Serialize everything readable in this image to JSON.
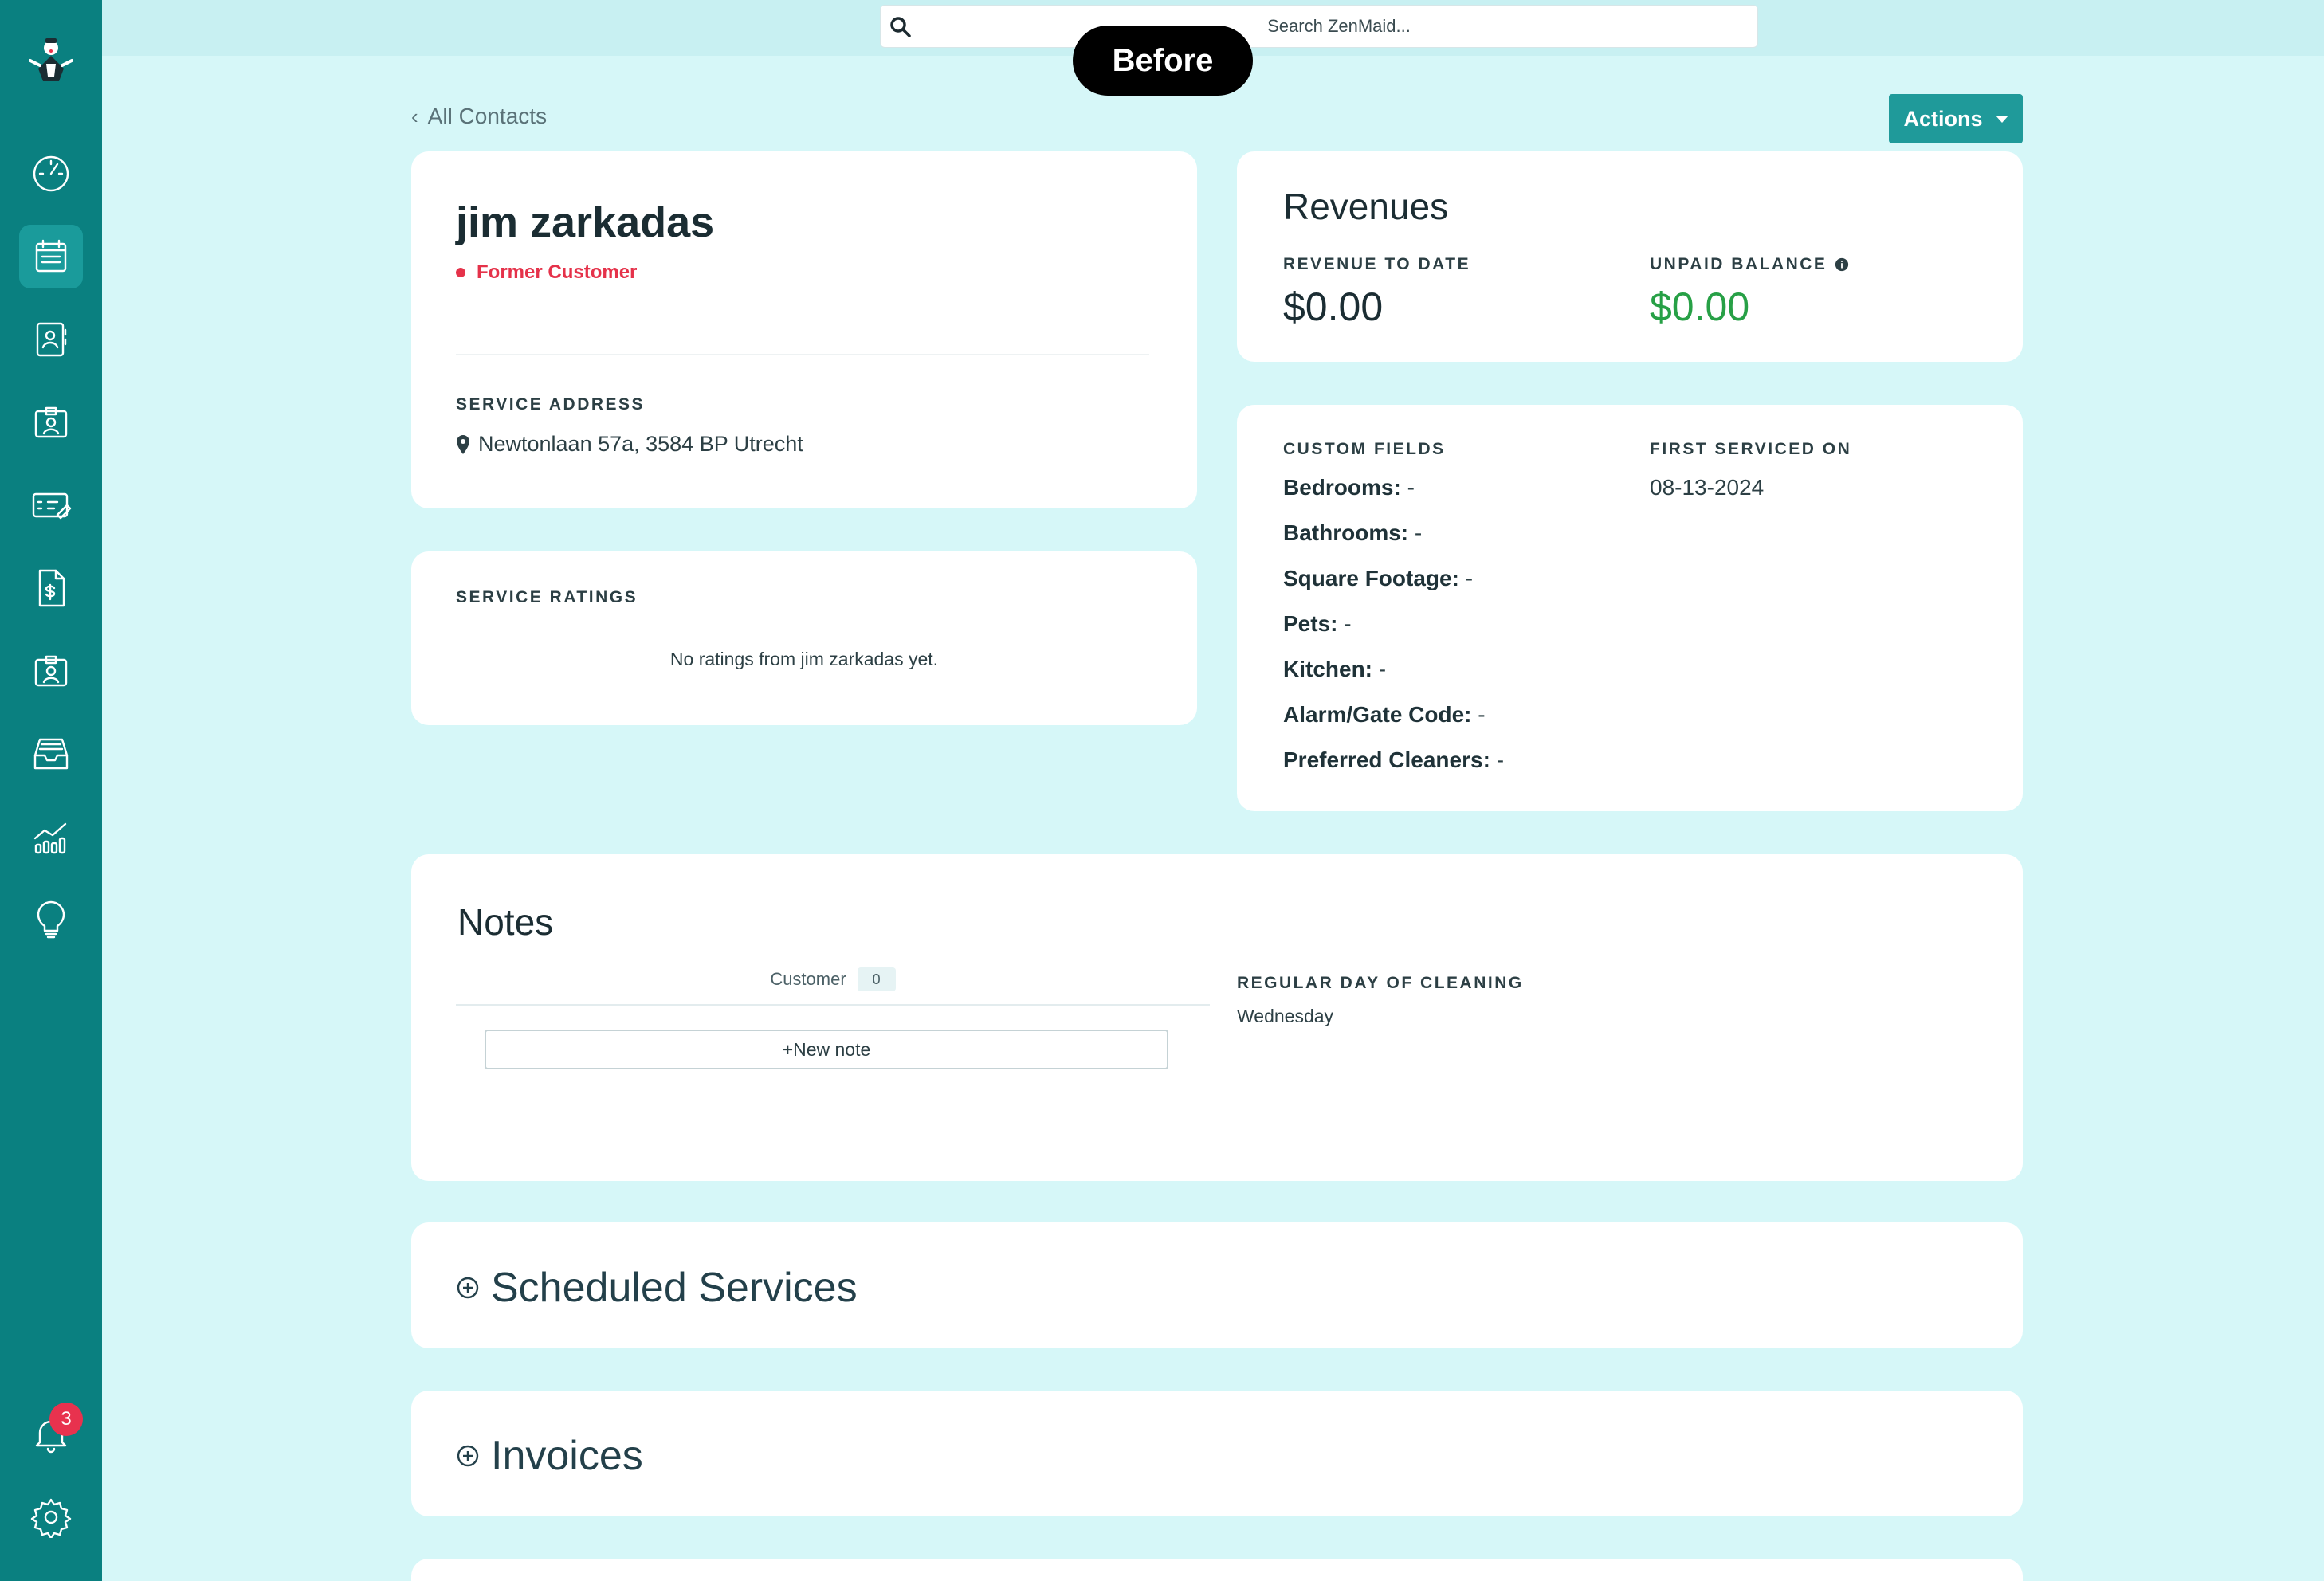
{
  "search": {
    "placeholder": "Search ZenMaid..."
  },
  "overlay": {
    "before_label": "Before"
  },
  "nav": {
    "back_label": "All Contacts",
    "actions_label": "Actions",
    "notification_count": "3"
  },
  "contact": {
    "name": "jim zarkadas",
    "status": "Former Customer",
    "service_address_label": "SERVICE ADDRESS",
    "service_address": "Newtonlaan 57a, 3584 BP Utrecht"
  },
  "ratings": {
    "label": "SERVICE RATINGS",
    "empty_text": "No ratings from jim zarkadas yet."
  },
  "revenues": {
    "title": "Revenues",
    "to_date_label": "REVENUE TO DATE",
    "to_date_value": "$0.00",
    "unpaid_label": "UNPAID BALANCE",
    "unpaid_value": "$0.00",
    "unpaid_color": "#27a046"
  },
  "custom_fields": {
    "label": "CUSTOM FIELDS",
    "items": [
      {
        "key": "Bedrooms:",
        "value": "-"
      },
      {
        "key": "Bathrooms:",
        "value": "-"
      },
      {
        "key": "Square Footage:",
        "value": "-"
      },
      {
        "key": "Pets:",
        "value": "-"
      },
      {
        "key": "Kitchen:",
        "value": "-"
      },
      {
        "key": "Alarm/Gate Code:",
        "value": "-"
      },
      {
        "key": "Preferred Cleaners:",
        "value": "-"
      }
    ],
    "first_serviced_label": "FIRST SERVICED ON",
    "first_serviced_value": "08-13-2024"
  },
  "notes": {
    "title": "Notes",
    "tab_label": "Customer",
    "tab_count": "0",
    "new_note_label": "+New note",
    "regular_day_label": "REGULAR DAY OF CLEANING",
    "regular_day_value": "Wednesday"
  },
  "sections": {
    "scheduled_services": "Scheduled Services",
    "invoices": "Invoices"
  },
  "sidebar": {
    "accent": "#0a8080",
    "items": [
      {
        "icon": "dashboard-gauge-icon"
      },
      {
        "icon": "calendar-icon",
        "active": true
      },
      {
        "icon": "contacts-book-icon"
      },
      {
        "icon": "id-badge-icon"
      },
      {
        "icon": "payment-card-icon"
      },
      {
        "icon": "invoice-dollar-icon"
      },
      {
        "icon": "team-badge-icon"
      },
      {
        "icon": "inbox-tray-icon"
      },
      {
        "icon": "reports-chart-icon"
      },
      {
        "icon": "lightbulb-icon"
      },
      {
        "icon": "bell-icon"
      },
      {
        "icon": "gear-icon"
      }
    ]
  }
}
